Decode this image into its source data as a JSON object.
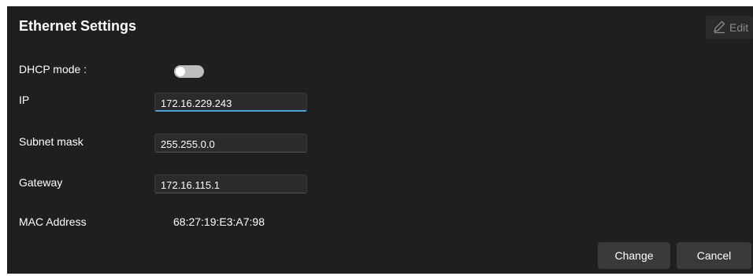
{
  "header": {
    "title": "Ethernet Settings",
    "edit_label": "Edit",
    "edit_icon": "pencil-icon"
  },
  "fields": {
    "dhcp": {
      "label": "DHCP mode :",
      "enabled": false
    },
    "ip": {
      "label": "IP",
      "value": "172.16.229.243"
    },
    "subnet": {
      "label": "Subnet mask",
      "value": "255.255.0.0"
    },
    "gateway": {
      "label": "Gateway",
      "value": "172.16.115.1"
    },
    "mac": {
      "label": "MAC Address",
      "value": "68:27:19:E3:A7:98"
    }
  },
  "actions": {
    "change_label": "Change",
    "cancel_label": "Cancel"
  },
  "colors": {
    "background": "#1f1f1f",
    "focus_accent": "#4fa3d9",
    "button_bg": "#3a3a3a",
    "toggle_off": "#bdbdbd"
  }
}
